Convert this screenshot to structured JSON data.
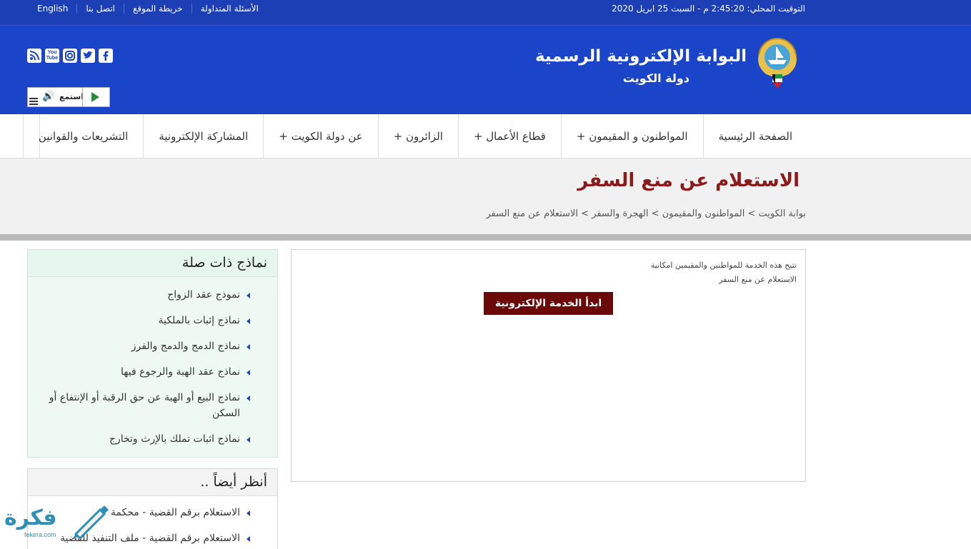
{
  "topbar": {
    "links": [
      "English",
      "اتصل بنا",
      "خريطة الموقع",
      "الأسئلة المتداولة"
    ],
    "clock": "التوقيت المحلي: 2:45:20 م - السبت 25 ابريل 2020"
  },
  "header": {
    "title": "البوابة الإلكترونية الرسمية",
    "subtitle": "دولة الكويت",
    "listen_label": "استمع",
    "social": [
      "rss-icon",
      "youtube-icon",
      "instagram-icon",
      "twitter-icon",
      "facebook-icon"
    ],
    "youtube_text": "You Tube"
  },
  "nav": {
    "items": [
      "الصفحة الرئيسية",
      "المواطنون و المقيمون +",
      "قطاع الأعمال +",
      "الزائرون +",
      "عن دولة الكويت +",
      "المشاركة الإلكترونية",
      "التشريعات والقوانين"
    ]
  },
  "page": {
    "title": "الاستعلام عن منع السفر",
    "breadcrumb": "بوابة الكويت > المواطنون والمقيمون > الهجرة والسفر > الاستعلام عن منع السفر"
  },
  "main": {
    "description": "تتيح هذه الخدمة للمواطنين والمقيمين امكانية الاستعلام عن منع السفر",
    "start_button": "ابدأ الخدمة الإلكترونية"
  },
  "related": {
    "title": "نماذج ذات صلة",
    "items": [
      "نموذج عقد الزواج",
      "نماذج إثبات بالملكية",
      "نماذج الدمج والدمج والفرز",
      "نماذج عقد الهبة والرجوع فيها",
      "نماذج البيع أو الهبة عن حق الرقبة أو الإنتفاع أو السكن",
      "نماذج اثبات تملك بالإرث وتخارج"
    ]
  },
  "see_also": {
    "title": "أنظر أيضاً ..",
    "items": [
      "الاستعلام برقم القضية - محكمة",
      "الاستعلام برقم القضية - ملف التنفيذ للقضية"
    ]
  },
  "watermark": {
    "text": "فكرة",
    "url": "fekera.com"
  },
  "colors": {
    "topbar": "#1d3fb6",
    "header": "#1a45c9",
    "title": "#8b1a1a",
    "button": "#6b0808",
    "related_bg": "#eef9f4"
  }
}
